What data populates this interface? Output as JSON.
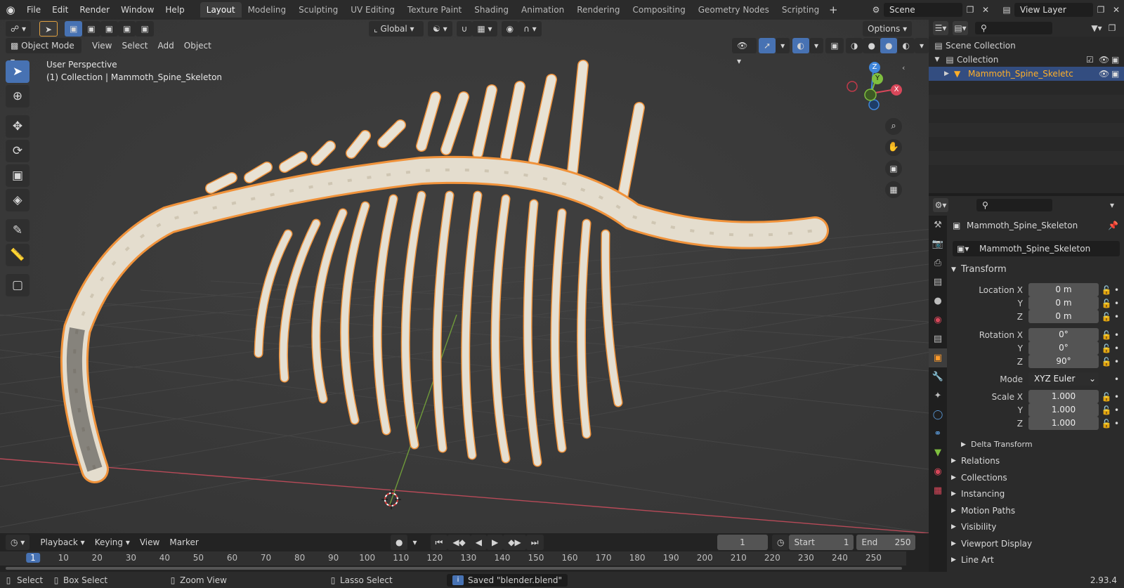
{
  "topbar": {
    "menus": [
      "File",
      "Edit",
      "Render",
      "Window",
      "Help"
    ],
    "workspaces": [
      "Layout",
      "Modeling",
      "Sculpting",
      "UV Editing",
      "Texture Paint",
      "Shading",
      "Animation",
      "Rendering",
      "Compositing",
      "Geometry Nodes",
      "Scripting"
    ],
    "active_workspace": "Layout",
    "scene": "Scene",
    "view_layer": "View Layer"
  },
  "viewport": {
    "transform_orientation": "Global",
    "options_label": "Options",
    "mode": "Object Mode",
    "header_menus": [
      "View",
      "Select",
      "Add",
      "Object"
    ],
    "overlay_title": "User Perspective",
    "overlay_subtitle": "(1) Collection | Mammoth_Spine_Skeleton",
    "gizmo": {
      "x": "X",
      "y": "Y",
      "z": "Z"
    }
  },
  "outliner": {
    "scene_collection": "Scene Collection",
    "collection": "Collection",
    "object": "Mammoth_Spine_Skeletc"
  },
  "properties": {
    "object_name": "Mammoth_Spine_Skeleton",
    "object_field": "Mammoth_Spine_Skeleton",
    "transform_header": "Transform",
    "location_label": "Location X",
    "location": [
      "0 m",
      "0 m",
      "0 m"
    ],
    "rotation_label": "Rotation X",
    "rotation": [
      "0°",
      "0°",
      "90°"
    ],
    "mode_label": "Mode",
    "mode_value": "XYZ Euler",
    "scale_label": "Scale X",
    "scale": [
      "1.000",
      "1.000",
      "1.000"
    ],
    "axis_y": "Y",
    "axis_z": "Z",
    "delta_transform": "Delta Transform",
    "sections": [
      "Relations",
      "Collections",
      "Instancing",
      "Motion Paths",
      "Visibility",
      "Viewport Display",
      "Line Art"
    ]
  },
  "timeline": {
    "menus": [
      "Playback",
      "Keying",
      "View",
      "Marker"
    ],
    "current_frame": "1",
    "start_label": "Start",
    "start": "1",
    "end_label": "End",
    "end": "250",
    "ruler": [
      "1",
      "10",
      "20",
      "30",
      "40",
      "50",
      "60",
      "70",
      "80",
      "90",
      "100",
      "110",
      "120",
      "130",
      "140",
      "150",
      "160",
      "170",
      "180",
      "190",
      "200",
      "210",
      "220",
      "230",
      "240",
      "250"
    ]
  },
  "status": {
    "select": "Select",
    "box_select": "Box Select",
    "zoom_view": "Zoom View",
    "lasso_select": "Lasso Select",
    "message": "Saved \"blender.blend\"",
    "version": "2.93.4"
  },
  "colors": {
    "accent_blue": "#4772b3",
    "selection_orange": "#ffaf29",
    "bone": "#e7e1d3",
    "outline": "#f2993c",
    "axis_x": "#d8475a",
    "axis_y": "#7fbf3f",
    "axis_z": "#3f86db"
  }
}
